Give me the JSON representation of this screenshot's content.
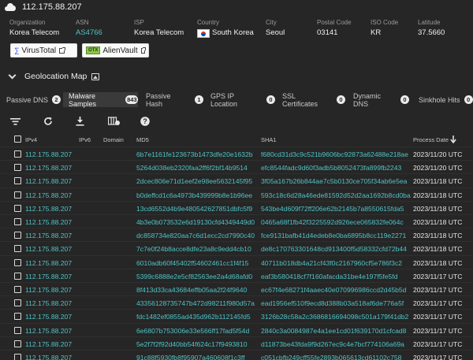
{
  "header": {
    "title": "112.175.88.207"
  },
  "info": {
    "organization": {
      "label": "Organization",
      "value": "Korea Telecom"
    },
    "asn": {
      "label": "ASN",
      "value": "AS4766"
    },
    "isp": {
      "label": "ISP",
      "value": "Korea Telecom"
    },
    "country": {
      "label": "Country",
      "value": "South Korea"
    },
    "city": {
      "label": "City",
      "value": "Seoul"
    },
    "postal": {
      "label": "Postal Code",
      "value": "03141"
    },
    "iso": {
      "label": "ISO Code",
      "value": "KR"
    },
    "latitude": {
      "label": "Latitude",
      "value": "37.5660"
    }
  },
  "external": {
    "virustotal": "VirusTotal",
    "alienvault": "AlienVault",
    "alienvault_logo": "OTX"
  },
  "geolocation": {
    "title": "Geolocation Map"
  },
  "tabs": [
    {
      "label": "Passive DNS",
      "count": "2"
    },
    {
      "label": "Malware Samples",
      "count": "843"
    },
    {
      "label": "Passive Hash",
      "count": "1"
    },
    {
      "label": "GPS IP Location",
      "count": "0"
    },
    {
      "label": "SSL Certificates",
      "count": "0"
    },
    {
      "label": "Dynamic DNS",
      "count": "0"
    },
    {
      "label": "Sinkhole Hits",
      "count": "0"
    }
  ],
  "table": {
    "columns": {
      "ipv4": "IPv4",
      "ipv6": "IPv6",
      "domain": "Domain",
      "md5": "MD5",
      "sha1": "SHA1",
      "date": "Process Date"
    },
    "rows": [
      {
        "ipv4": "112.175.88.207",
        "md5": "6b7e1161fe123673b1473dfe20e1632b",
        "sha1": "f680cd31d3c9c521b9606bc92873a62488e218ae",
        "date": "2023/11/20 UTC"
      },
      {
        "ipv4": "112.175.88.207",
        "md5": "5264d038eb2320faa2ff6f2bf14b9514",
        "sha1": "efc8544fadc9d60f3adb5b8052473fa899fb2243",
        "date": "2023/11/20 UTC"
      },
      {
        "ipv4": "112.175.88.207",
        "md5": "2dcec806e71d1eef2e98ee5632145f95",
        "sha1": "3f05a167b26b844ae7c5b0130ce705f34ab6e5ea",
        "date": "2023/11/18 UTC"
      },
      {
        "ipv4": "112.175.88.207",
        "md5": "b0deffcd1c6a4973b439999b8e1b96ee",
        "sha1": "593c18c6d28a46ede81592d52d2aa1692b8cd0ba",
        "date": "2023/11/18 UTC"
      },
      {
        "ipv4": "112.175.88.207",
        "md5": "13cd6552d4b9e480542627851dbfc5f9",
        "sha1": "543be4d609f72ff206e62b2145b7a8550615fda5",
        "date": "2023/11/18 UTC"
      },
      {
        "ipv4": "112.175.88.207",
        "md5": "4b3e0b073532e6d19130cfd4349449d0",
        "sha1": "0465a68f1fb42f3225592d926ece065832fe064c",
        "date": "2023/11/18 UTC"
      },
      {
        "ipv4": "112.175.88.207",
        "md5": "dc858734e820aa7c6d1ecc2cd7990c40",
        "sha1": "fce9131bafb41d4edeb8e0ba6895b8cc119e2271",
        "date": "2023/11/18 UTC"
      },
      {
        "ipv4": "112.175.88.207",
        "md5": "7c7e0f24b8acce8dfe23a8c9edd4cb10",
        "sha1": "de8c170763301648cd913400f5d58332cfd72b44",
        "date": "2023/11/18 UTC"
      },
      {
        "ipv4": "112.175.88.207",
        "md5": "6010adb60f45402f54602461cc1f4f15",
        "sha1": "40711b018db4a21cf43f0c2167960cf5e786f3c2",
        "date": "2023/11/18 UTC"
      },
      {
        "ipv4": "112.175.88.207",
        "md5": "5399c6888e2e5cf82563ee2a4d68afd0",
        "sha1": "eaf3b580418cf7f160afacda31be4e197f5fe5fd",
        "date": "2023/11/17 UTC"
      },
      {
        "ipv4": "112.175.88.207",
        "md5": "8f413d33ca43684effb05aa2f24f9640",
        "sha1": "ec67f4e68271f4aaec40e070996986ccd2d45b5d",
        "date": "2023/11/17 UTC"
      },
      {
        "ipv4": "112.175.88.207",
        "md5": "43356128735747b472d98211f980d57a",
        "sha1": "ead1956ef510f9ecd8d388b03a518af6de776a5f",
        "date": "2023/11/17 UTC"
      },
      {
        "ipv4": "112.175.88.207",
        "md5": "fdc1482ef0855ad435d962b112145fd5",
        "sha1": "3126b28c58a2c3686816694098c501a179f41db2",
        "date": "2023/11/17 UTC"
      },
      {
        "ipv4": "112.175.88.207",
        "md5": "6e6807b753006e33e566ff17fad5f54d",
        "sha1": "2840c3a0084987e4a1ee1cd01f639170d1cfcad8",
        "date": "2023/11/17 UTC"
      },
      {
        "ipv4": "112.175.88.207",
        "md5": "5e2f7f2f92d40bb54f624c17f9493810",
        "sha1": "d11873be43fda9f9d267ec9c4e7bcf774106a69a",
        "date": "2023/11/17 UTC"
      },
      {
        "ipv4": "112.175.88.207",
        "md5": "91c88f5930fb8f95907a460608f1c3ff",
        "sha1": "c051cbfb249cff55fe2893b065613cd61102c758",
        "date": "2023/11/17 UTC"
      }
    ]
  },
  "colors": {
    "background": "#262626",
    "link": "#4fc3c6",
    "text": "#e6e6e6",
    "muted": "#9a9a9a"
  }
}
